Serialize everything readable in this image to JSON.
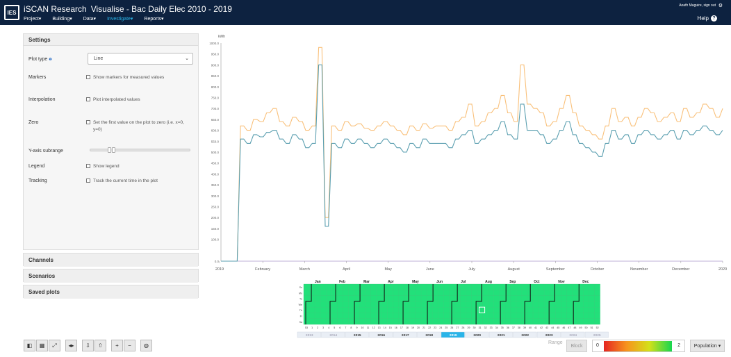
{
  "header": {
    "logo": "IES",
    "brand": "iSCAN Research",
    "page_title": "Visualise - Bac Daily Elec 2010 - 2019",
    "menu": [
      "Project",
      "Building",
      "Data",
      "Investigate",
      "Reports"
    ],
    "active_menu": "Investigate",
    "user_line": "Aoath Maguire, sign out",
    "help": "Help"
  },
  "settings": {
    "title": "Settings",
    "plot_type_label": "Plot type",
    "plot_type_value": "Line",
    "markers_label": "Markers",
    "markers_option": "Show markers for measured values",
    "interpolation_label": "Interpolation",
    "interpolation_option": "Plot interpolated values",
    "zero_label": "Zero",
    "zero_option_1": "Set the first value on the plot to zero (i.e. x=0,",
    "zero_option_2": "y=0)",
    "yaxis_label": "Y-axis subrange",
    "legend_label": "Legend",
    "legend_option": "Show legend",
    "tracking_label": "Tracking",
    "tracking_option": "Track the current time in the plot"
  },
  "panels": {
    "channels": "Channels",
    "scenarios": "Scenarios",
    "saved_plots": "Saved plots"
  },
  "chart_data": {
    "type": "line",
    "ylabel": "kWh",
    "ylim": [
      0,
      1000
    ],
    "yticks": [
      "0.0",
      "100.0",
      "150.0",
      "200.0",
      "250.0",
      "300.0",
      "350.0",
      "400.0",
      "450.0",
      "500.0",
      "550.0",
      "600.0",
      "650.0",
      "700.0",
      "750.0",
      "800.0",
      "850.0",
      "900.0",
      "950.0",
      "1000.0"
    ],
    "xlabels": [
      "2019",
      "February",
      "March",
      "April",
      "May",
      "June",
      "July",
      "August",
      "September",
      "October",
      "November",
      "December",
      "2020"
    ],
    "grid": false,
    "series": [
      {
        "values_note": "",
        "color": "#f9c07a",
        "values": [
          0,
          0,
          0,
          620,
          600,
          650,
          640,
          680,
          700,
          640,
          620,
          660,
          640,
          600,
          620,
          980,
          200,
          620,
          600,
          640,
          620,
          630,
          610,
          600,
          620,
          640,
          620,
          600,
          580,
          620,
          600,
          630,
          610,
          620,
          620,
          600,
          640,
          660,
          720,
          620,
          640,
          680,
          700,
          760,
          680,
          640,
          900,
          720,
          700,
          680,
          620,
          640,
          700,
          760,
          680,
          620,
          600,
          580,
          560,
          620,
          700,
          640,
          660,
          620,
          660,
          700,
          680,
          640,
          660,
          680,
          640,
          700,
          660,
          680,
          720,
          700,
          660,
          700
        ]
      },
      {
        "values_note": "",
        "color": "#5b9fb0",
        "values": [
          0,
          0,
          0,
          560,
          540,
          580,
          570,
          590,
          600,
          560,
          540,
          580,
          560,
          520,
          540,
          900,
          160,
          540,
          520,
          560,
          540,
          560,
          540,
          520,
          540,
          560,
          540,
          520,
          500,
          540,
          520,
          560,
          540,
          540,
          540,
          520,
          560,
          580,
          600,
          540,
          560,
          580,
          600,
          640,
          580,
          560,
          720,
          600,
          600,
          580,
          540,
          560,
          600,
          640,
          580,
          540,
          520,
          500,
          480,
          540,
          600,
          560,
          580,
          540,
          580,
          600,
          580,
          560,
          580,
          600,
          560,
          600,
          580,
          600,
          620,
          600,
          580,
          600
        ]
      }
    ]
  },
  "calendar": {
    "months": [
      "Jan",
      "Feb",
      "Mar",
      "Apr",
      "May",
      "Jun",
      "Jul",
      "Aug",
      "Sep",
      "Oct",
      "Nov",
      "Dec"
    ],
    "days": [
      "Su",
      "Mo",
      "Tu",
      "We",
      "Th",
      "Fr",
      "Sa"
    ],
    "weeks": [
      "53",
      "1",
      "2",
      "3",
      "4",
      "5",
      "6",
      "7",
      "8",
      "9",
      "10",
      "11",
      "12",
      "13",
      "14",
      "15",
      "16",
      "17",
      "18",
      "19",
      "20",
      "21",
      "22",
      "23",
      "24",
      "25",
      "26",
      "27",
      "28",
      "29",
      "30",
      "31",
      "32",
      "33",
      "34",
      "35",
      "36",
      "37",
      "38",
      "39",
      "40",
      "41",
      "42",
      "43",
      "44",
      "45",
      "46",
      "47",
      "48",
      "49",
      "50",
      "51",
      "52"
    ],
    "years": [
      "2013",
      "2014",
      "2015",
      "2016",
      "2017",
      "2018",
      "2019",
      "2020",
      "2021",
      "2022",
      "2023",
      "2024",
      "2025"
    ],
    "selected_year": "2019",
    "cell_color": "#22e07a"
  },
  "bottom": {
    "range": "Range",
    "block": "Block",
    "legend_min": "0",
    "legend_max": "2",
    "population": "Population"
  }
}
